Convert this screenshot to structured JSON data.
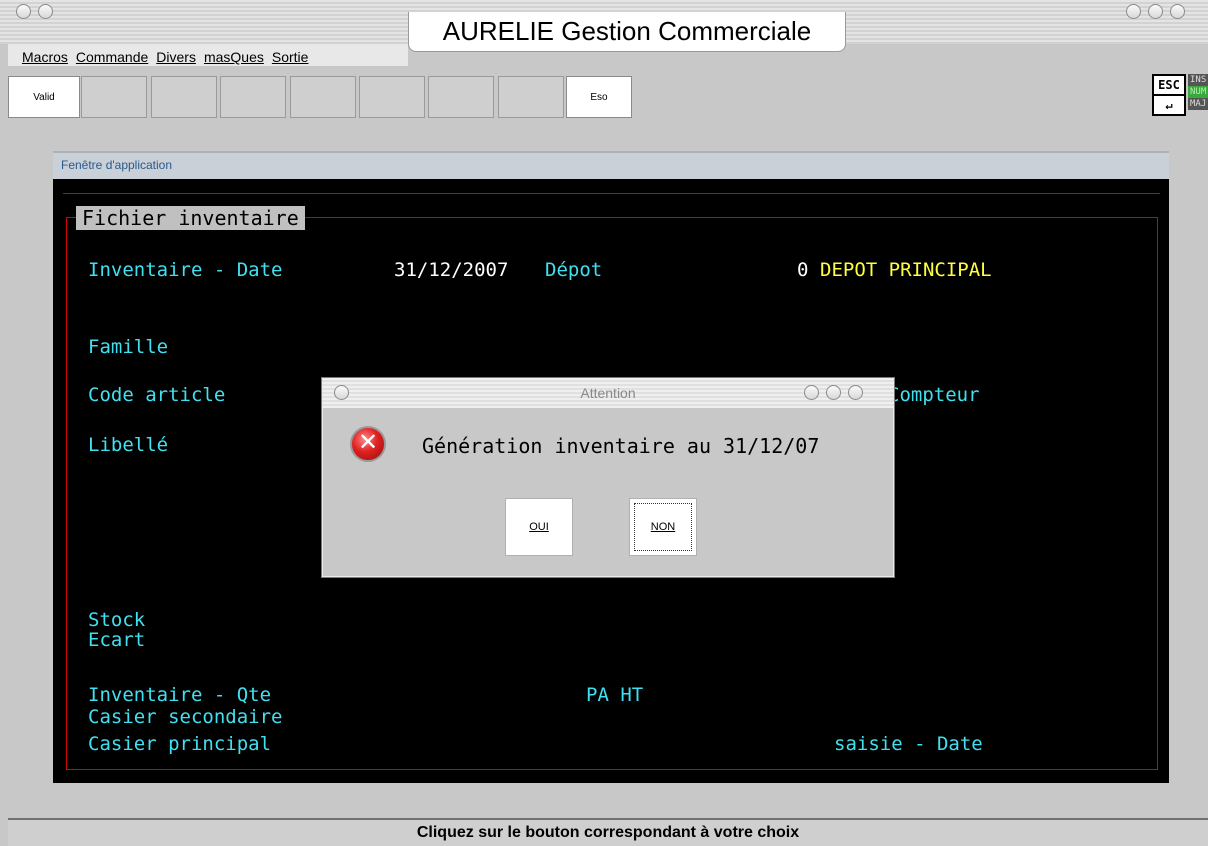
{
  "window": {
    "title": "AURELIE Gestion Commerciale"
  },
  "menu": {
    "items": [
      "Macros",
      "Commande",
      "Divers",
      "masQues",
      "Sortie"
    ]
  },
  "toolbar": {
    "valid_label": "Valid",
    "eso_label": "Eso",
    "esc_label": "ESC",
    "enter_label": "↵",
    "indicators": [
      "INS",
      "NUM",
      "MAJ"
    ]
  },
  "app_window": {
    "title": "Fenêtre d'application",
    "section_title": "Fichier inventaire",
    "fields": {
      "inventaire_date_label": "Inventaire - Date",
      "inventaire_date_value": "31/12/2007",
      "depot_label": "Dépot",
      "depot_code": "0",
      "depot_name": "DEPOT PRINCIPAL",
      "famille_label": "Famille",
      "code_article_label": "Code article",
      "compteur_label": "Compteur",
      "libelle_label": "Libellé",
      "stock_label": "Stock",
      "ecart_label": "Ecart",
      "inventaire_qte_label": "Inventaire - Qte",
      "pa_ht_label": "PA HT",
      "casier_secondaire_label": "Casier secondaire",
      "casier_principal_label": "Casier principal",
      "saisie_date_label": "saisie - Date"
    }
  },
  "dialog": {
    "title": "Attention",
    "message": "Génération inventaire au 31/12/07",
    "yes_label": "OUI",
    "no_label": "NON"
  },
  "status": {
    "text": "Cliquez sur le bouton correspondant à votre choix"
  }
}
